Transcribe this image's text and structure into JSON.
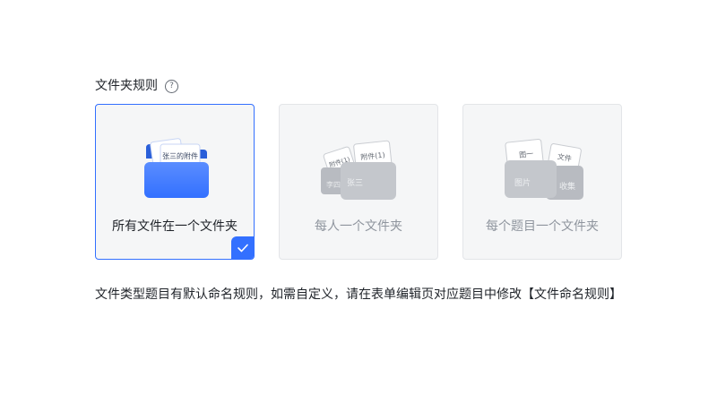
{
  "section": {
    "title": "文件夹规则",
    "help_icon": "question-circle-icon"
  },
  "options": [
    {
      "label": "所有文件在一个文件夹",
      "selected": true,
      "illustration": "blue-folder-icon",
      "papers": [
        "张三的附件"
      ]
    },
    {
      "label": "每人一个文件夹",
      "selected": false,
      "illustration": "gray-folders-icon",
      "papers": [
        "附件(1)",
        "附件(1)"
      ],
      "folders": [
        "李四",
        "张三"
      ]
    },
    {
      "label": "每个题目一个文件夹",
      "selected": false,
      "illustration": "gray-folders-icon",
      "papers": [
        "图一",
        "文件"
      ],
      "folders": [
        "图片",
        "收集"
      ]
    }
  ],
  "description": "文件类型题目有默认命名规则，如需自定义，请在表单编辑页对应题目中修改【文件命名规则】",
  "colors": {
    "accent": "#3370ff",
    "text": "#1f2329",
    "muted": "#8f959e",
    "card_bg": "#f5f6f7"
  }
}
